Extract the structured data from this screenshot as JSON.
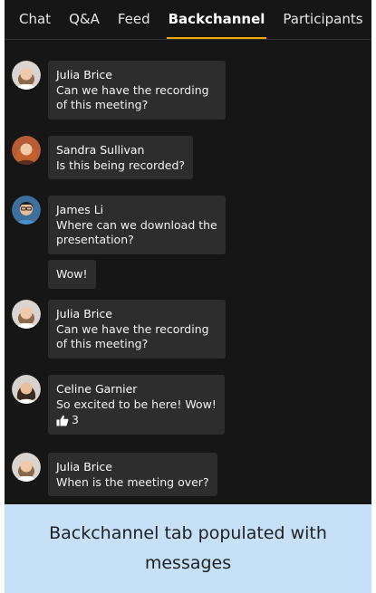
{
  "tabs": [
    {
      "label": "Chat"
    },
    {
      "label": "Q&A"
    },
    {
      "label": "Feed"
    },
    {
      "label": "Backchannel"
    },
    {
      "label": "Participants"
    }
  ],
  "active_tab": "Backchannel",
  "accent_color": "#f2a900",
  "messages": [
    {
      "name": "Julia Brice",
      "text": "Can we have the recording of this meeting?"
    },
    {
      "name": "Sandra Sullivan",
      "text": "Is this being recorded?"
    },
    {
      "name": "James Li",
      "text": "Where can we download the presentation?",
      "followup": "Wow!"
    },
    {
      "name": "Julia Brice",
      "text": "Can we have the recording of this meeting?"
    },
    {
      "name": "Celine Garnier",
      "text": "So excited to be here! Wow!",
      "likes": "3"
    },
    {
      "name": "Julia Brice",
      "text": "When is the meeting over?"
    }
  ],
  "caption": "Backchannel tab populated with messages"
}
